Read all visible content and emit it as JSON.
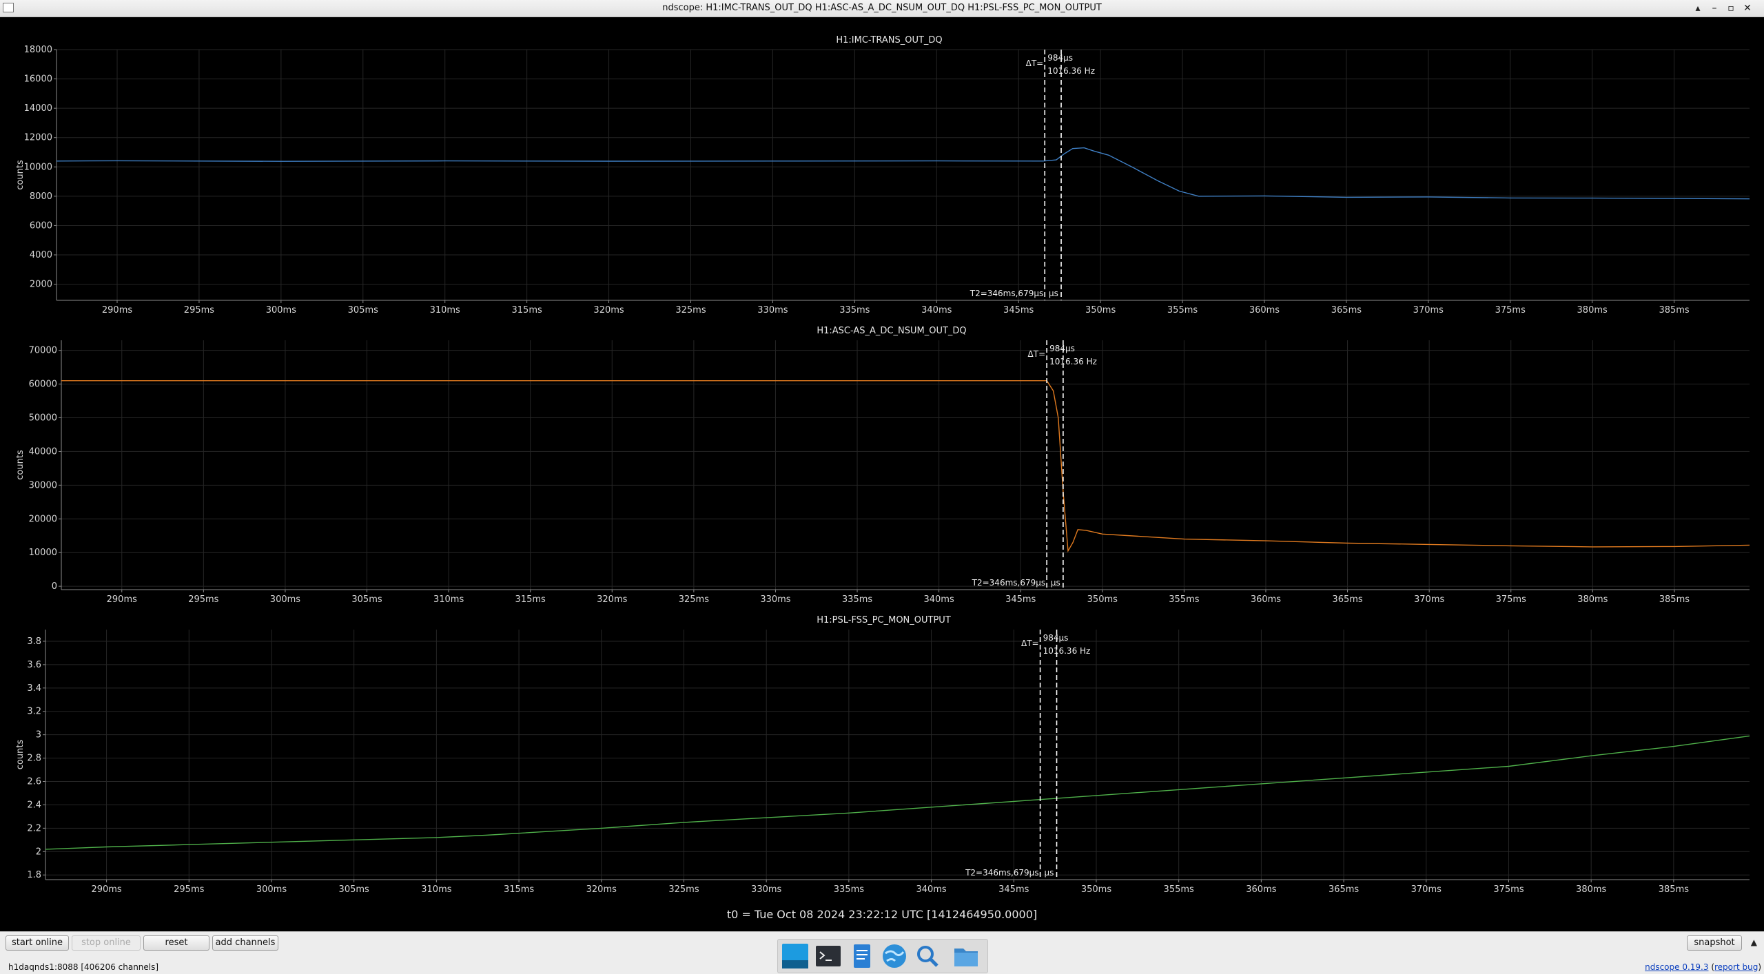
{
  "window": {
    "title": "ndscope: H1:IMC-TRANS_OUT_DQ H1:ASC-AS_A_DC_NSUM_OUT_DQ H1:PSL-FSS_PC_MON_OUTPUT",
    "controls": [
      "▴",
      "–",
      "▫",
      "✕"
    ]
  },
  "plots": [
    {
      "channel": "H1:IMC-TRANS_OUT_DQ",
      "ylabel": "counts",
      "color": "#3f7fc4",
      "ylim": [
        900,
        18000
      ],
      "yticks": [
        2000,
        4000,
        6000,
        8000,
        10000,
        12000,
        14000,
        16000,
        18000
      ]
    },
    {
      "channel": "H1:ASC-AS_A_DC_NSUM_OUT_DQ",
      "ylabel": "counts",
      "color": "#e07a1f",
      "ylim": [
        -1000,
        73000
      ],
      "yticks": [
        0,
        10000,
        20000,
        30000,
        40000,
        50000,
        60000,
        70000
      ]
    },
    {
      "channel": "H1:PSL-FSS_PC_MON_OUTPUT",
      "ylabel": "counts",
      "color": "#4fb04a",
      "ylim": [
        1.76,
        3.9
      ],
      "yticks": [
        1.8,
        2,
        2.2,
        2.4,
        2.6,
        2.8,
        3,
        3.2,
        3.4,
        3.6,
        3.8
      ]
    }
  ],
  "xaxis": {
    "ticks": [
      "290ms",
      "295ms",
      "300ms",
      "305ms",
      "310ms",
      "315ms",
      "320ms",
      "325ms",
      "330ms",
      "335ms",
      "340ms",
      "345ms",
      "350ms",
      "355ms",
      "360ms",
      "365ms",
      "370ms",
      "375ms",
      "380ms",
      "385ms"
    ]
  },
  "cursors": {
    "delta_label": "ΔT=",
    "delta_time": "984μs",
    "frequency": "1016.36 Hz",
    "t2_label": "T2=346ms,679μs",
    "t2_tail": "μs"
  },
  "t0_label": "t0 = Tue Oct 08 2024 23:22:12 UTC [1412464950.0000]",
  "toolbar": {
    "start_online": "start online",
    "stop_online": "stop online",
    "reset": "reset",
    "add_channels": "add channels",
    "snapshot": "snapshot"
  },
  "status": "h1daqnds1:8088  [406206 channels]",
  "version": {
    "app": "ndscope 0.19.3",
    "report": "report bug"
  },
  "taskbar_icons": [
    "desktop-icon",
    "terminal-icon",
    "text-editor-icon",
    "web-browser-icon",
    "search-icon",
    "file-manager-icon"
  ],
  "chart_data": [
    {
      "type": "line",
      "title": "H1:IMC-TRANS_OUT_DQ",
      "ylabel": "counts",
      "xlim_ms": [
        286.3,
        389.6
      ],
      "ylim": [
        900,
        18000
      ],
      "series": [
        {
          "x": [
            286.3,
            290,
            300,
            310,
            320,
            330,
            340,
            346.5,
            347.3,
            347.8,
            348.3,
            349,
            349.6,
            350.5,
            352,
            353.5,
            354.8,
            356,
            360,
            365,
            370,
            375,
            380,
            385,
            389.6
          ],
          "values": [
            10400,
            10420,
            10380,
            10410,
            10390,
            10400,
            10410,
            10400,
            10480,
            10900,
            11250,
            11300,
            11080,
            10800,
            9950,
            9050,
            8350,
            8000,
            8020,
            7930,
            7950,
            7880,
            7870,
            7850,
            7820
          ]
        }
      ]
    },
    {
      "type": "line",
      "title": "H1:ASC-AS_A_DC_NSUM_OUT_DQ",
      "ylabel": "counts",
      "xlim_ms": [
        286.3,
        389.6
      ],
      "ylim": [
        -1000,
        73000
      ],
      "series": [
        {
          "x": [
            286.3,
            300,
            320,
            340,
            346.6,
            347,
            347.3,
            347.6,
            347.9,
            348.2,
            348.5,
            349,
            350,
            355,
            360,
            365,
            370,
            375,
            380,
            385,
            389.6
          ],
          "values": [
            61000,
            61000,
            61000,
            61000,
            61000,
            58000,
            50000,
            28000,
            10500,
            13000,
            16800,
            16600,
            15500,
            14000,
            13500,
            12800,
            12400,
            12000,
            11700,
            11800,
            12200
          ]
        }
      ]
    },
    {
      "type": "line",
      "title": "H1:PSL-FSS_PC_MON_OUTPUT",
      "ylabel": "counts",
      "xlim_ms": [
        286.3,
        389.6
      ],
      "ylim": [
        1.76,
        3.9
      ],
      "series": [
        {
          "x": [
            286.3,
            290,
            295,
            300,
            305,
            310,
            313,
            320,
            325,
            330,
            335,
            340,
            345,
            350,
            355,
            360,
            365,
            370,
            375,
            380,
            385,
            389.6
          ],
          "values": [
            2.02,
            2.04,
            2.06,
            2.08,
            2.1,
            2.12,
            2.14,
            2.2,
            2.25,
            2.29,
            2.33,
            2.38,
            2.43,
            2.48,
            2.53,
            2.58,
            2.63,
            2.68,
            2.73,
            2.82,
            2.9,
            2.99
          ]
        }
      ]
    }
  ],
  "cursor_positions_ms": [
    346.6,
    347.6
  ],
  "colors": {
    "grid": "#262626",
    "axis": "#8c8c8c",
    "cursor": "#ffffff"
  }
}
